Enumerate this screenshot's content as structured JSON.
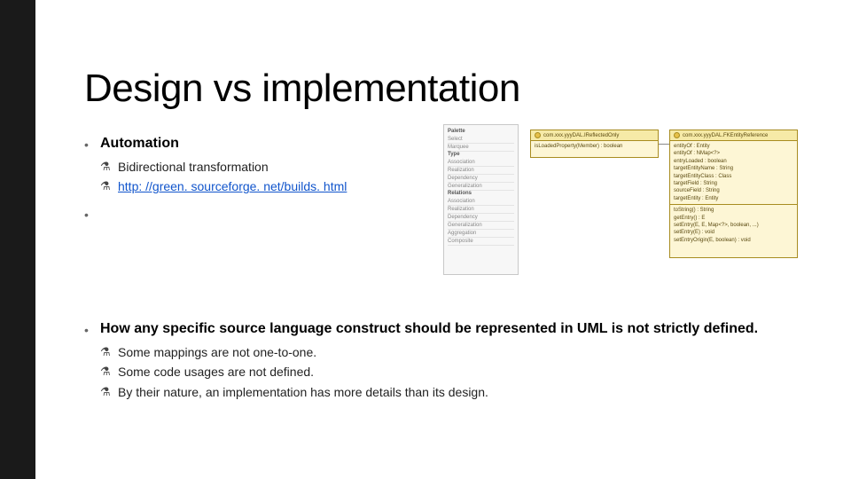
{
  "title": "Design vs implementation",
  "bullets": [
    {
      "head": "Automation",
      "subs": [
        {
          "text": "Bidirectional transformation",
          "link": false
        },
        {
          "text": "http: //green. sourceforge. net/builds. html",
          "link": true
        }
      ]
    },
    {
      "head": "How any specific source language construct should be represented in UML is not strictly defined.",
      "subs": [
        {
          "text": "Some mappings are not one-to-one.",
          "link": false
        },
        {
          "text": "Some code usages are not defined.",
          "link": false
        },
        {
          "text": "By their nature, an implementation has more details than its design.",
          "link": false
        }
      ]
    }
  ],
  "figure": {
    "panel": {
      "header": "Palette",
      "sections": [
        "Select",
        "Marquee",
        "Type",
        "Association",
        "Realization",
        "Dependency",
        "Generalization",
        "Relations",
        "Association",
        "Realization",
        "Dependency",
        "Generalization",
        "Aggregation",
        "Composite"
      ]
    },
    "classA": {
      "name": "com.xxx.yyyDAL.IReflectedOnly",
      "members": [
        "isLoadedProperty(Member) : boolean"
      ]
    },
    "classB": {
      "name": "com.xxx.yyyDAL.FKEntityReference",
      "members": [
        "entityOf : Entity",
        "entityOf : NMap<?>",
        "entryLoaded : boolean",
        "targetEntityName : String",
        "targetEntityClass : Class",
        "targetField : String",
        "sourceField : String",
        "targetEntity : Entity"
      ],
      "methods": [
        "toString() : String",
        "getEntry() : E",
        "setEntry(E, E, Map<?>, boolean, ...)",
        "setEntry(E) : void",
        "setEntryOrigin(E, boolean) : void"
      ]
    }
  },
  "bulletGlyph": "⚗"
}
